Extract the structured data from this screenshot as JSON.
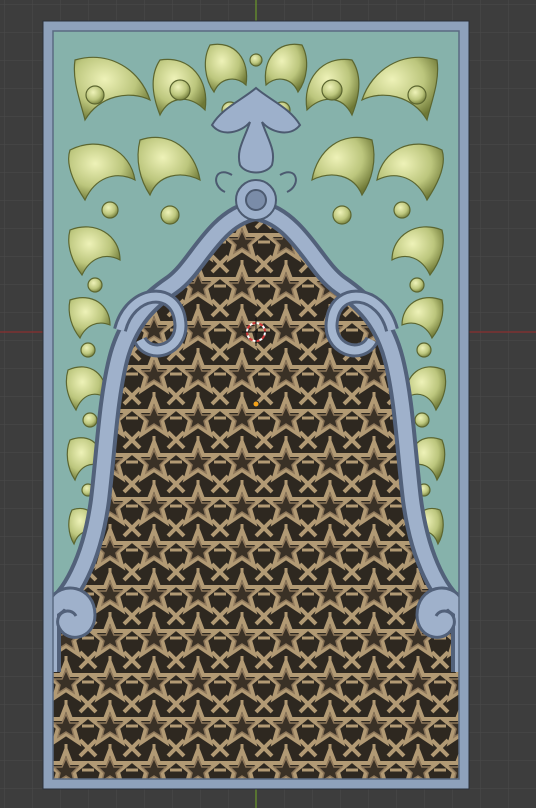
{
  "viewport": {
    "background": "#3d3d3d",
    "grid_color": "#4a4a4a",
    "x_axis_color": "#9a3030",
    "y_axis_color": "#6f9a2a"
  },
  "panel": {
    "frame_color": "#8a9fb9",
    "frame_edge": "#5c6c80",
    "teal_background": "#88b5ae",
    "ornament_color": "#c3cd86",
    "ornament_dark": "#6f7a3a",
    "arch_color": "#8da0bd",
    "arch_shadow": "#4c5a70",
    "lattice_color": "#a8906c",
    "lattice_shadow": "#2e2820"
  },
  "icons": {
    "cursor": "3d-cursor-icon",
    "origin": "object-origin-icon"
  }
}
